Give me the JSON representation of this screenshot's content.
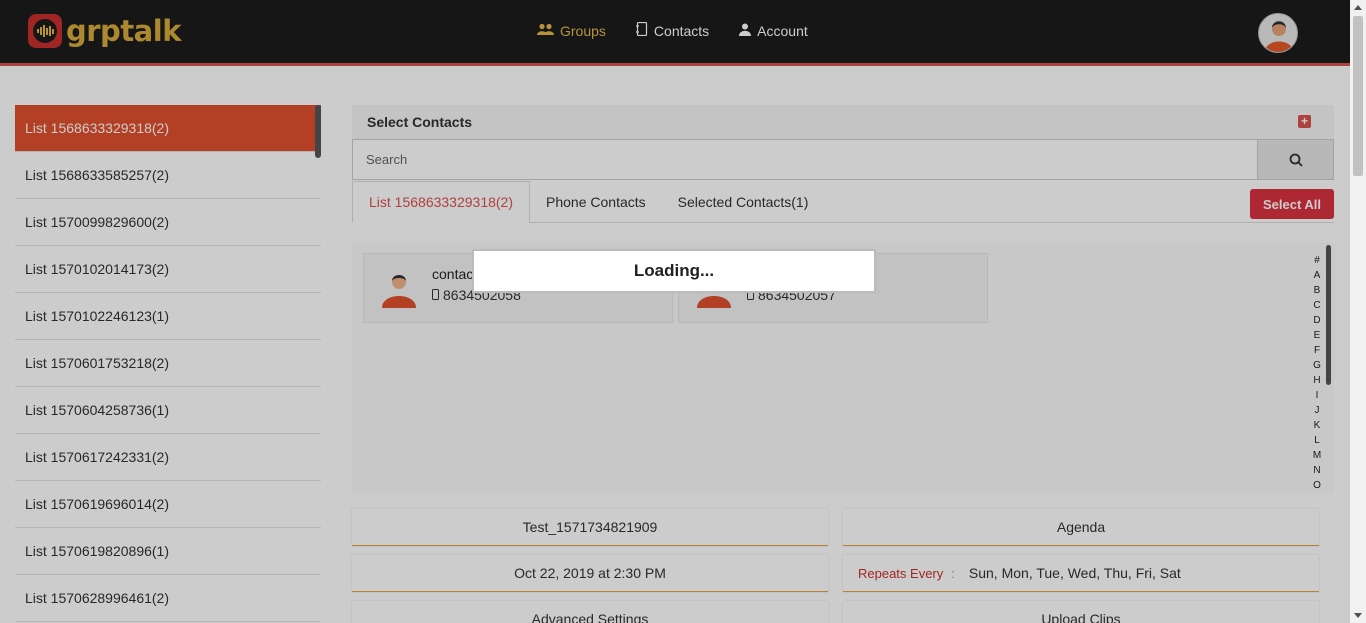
{
  "brand": {
    "name": "grptalk"
  },
  "nav": {
    "items": [
      {
        "label": "Groups",
        "icon": "users-icon",
        "active": true
      },
      {
        "label": "Contacts",
        "icon": "address-book-icon",
        "active": false
      },
      {
        "label": "Account",
        "icon": "user-icon",
        "active": false
      }
    ]
  },
  "sidebar": {
    "items": [
      {
        "label": "List 1568633329318(2)"
      },
      {
        "label": "List 1568633585257(2)"
      },
      {
        "label": "List 1570099829600(2)"
      },
      {
        "label": "List 1570102014173(2)"
      },
      {
        "label": "List 1570102246123(1)"
      },
      {
        "label": "List 1570601753218(2)"
      },
      {
        "label": "List 1570604258736(1)"
      },
      {
        "label": "List 1570617242331(2)"
      },
      {
        "label": "List 1570619696014(2)"
      },
      {
        "label": "List 1570619820896(1)"
      },
      {
        "label": "List 1570628996461(2)"
      }
    ]
  },
  "panel": {
    "title": "Select Contacts",
    "search_placeholder": "Search",
    "tabs": [
      {
        "label": "List 1568633329318(2)",
        "active": true
      },
      {
        "label": "Phone Contacts",
        "active": false
      },
      {
        "label": "Selected Contacts(1)",
        "active": false
      }
    ],
    "select_all_label": "Select All"
  },
  "contacts": [
    {
      "name": "contac",
      "phone": "8634502058"
    },
    {
      "name": "",
      "phone": "8634502057"
    }
  ],
  "alpha_index": [
    "#",
    "A",
    "B",
    "C",
    "D",
    "E",
    "F",
    "G",
    "H",
    "I",
    "J",
    "K",
    "L",
    "M",
    "N",
    "O"
  ],
  "group_details": {
    "group_name": "Test_1571734821909",
    "agenda_label": "Agenda",
    "schedule": "Oct 22, 2019 at 2:30 PM",
    "repeats_label": "Repeats Every",
    "repeats_sep": ":",
    "repeats_days": "Sun, Mon, Tue, Wed, Thu, Fri, Sat",
    "advanced_settings_label": "Advanced Settings",
    "upload_clips_label": "Upload Clips"
  },
  "loading": {
    "text": "Loading..."
  },
  "colors": {
    "accent": "#d9534f",
    "active_list": "#e0502f",
    "brand_gold": "#d8aa3b",
    "header_bg": "#1c1c1c"
  }
}
